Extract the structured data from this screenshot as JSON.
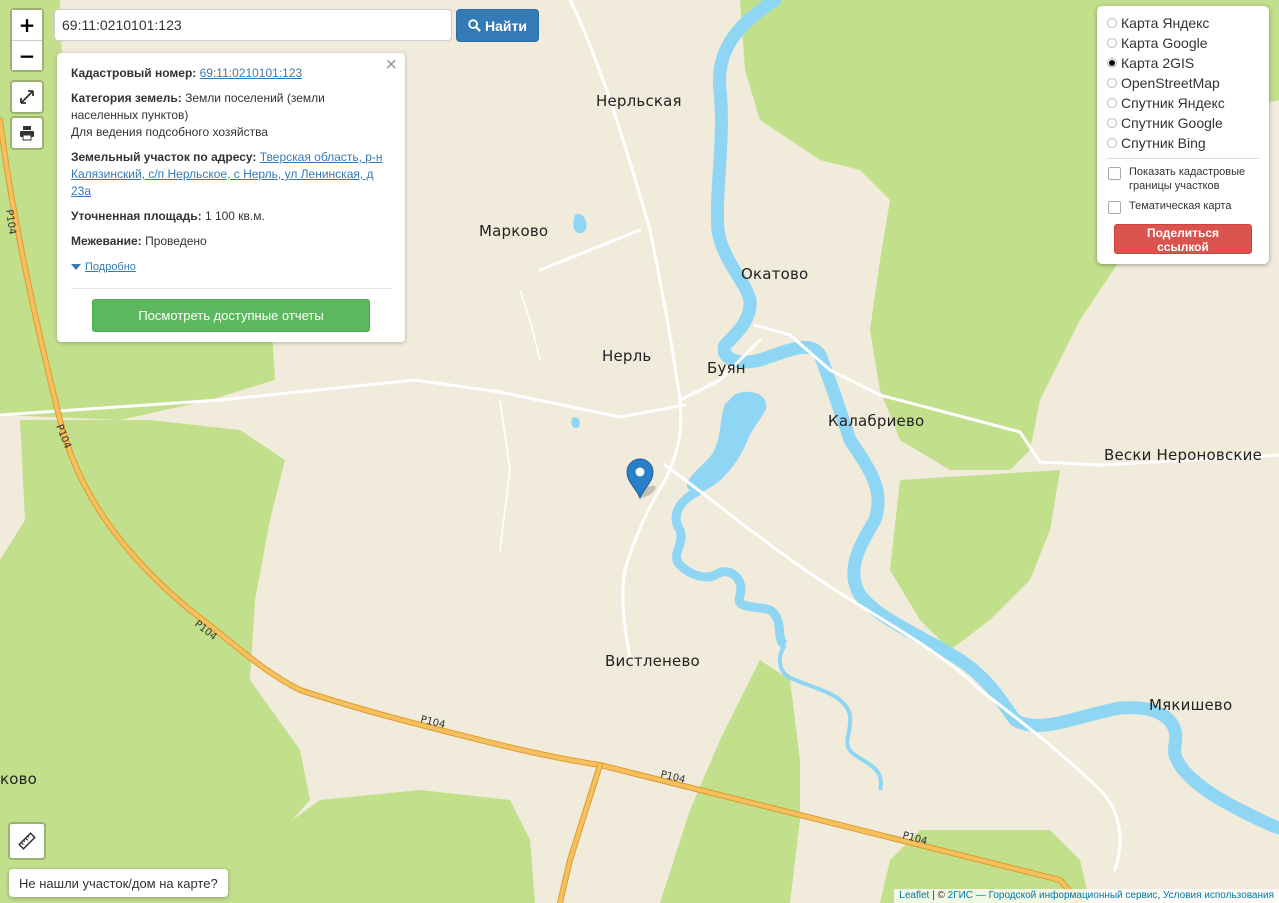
{
  "search": {
    "value": "69:11:0210101:123",
    "button_label": "Найти"
  },
  "zoom": {
    "in": "+",
    "out": "−"
  },
  "info": {
    "cadastral_label": "Кадастровый номер:",
    "cadastral_value": "69:11:0210101:123",
    "category_label": "Категория земель:",
    "category_value": "Земли поселений (земли населенных пунктов)",
    "category_note": "Для ведения подсобного хозяйства",
    "address_label": "Земельный участок по адресу:",
    "address_value": "Тверская область, р-н Калязинский, с/п Нерльское, с Нерль, ул Ленинская, д 23а",
    "area_label": "Уточненная площадь:",
    "area_value": "1 100 кв.м.",
    "survey_label": "Межевание:",
    "survey_value": "Проведено",
    "more_label": "Подробно",
    "reports_button": "Посмотреть доступные отчеты"
  },
  "layers": {
    "options": [
      "Карта Яндекс",
      "Карта Google",
      "Карта 2GIS",
      "OpenStreetMap",
      "Спутник Яндекс",
      "Спутник Google",
      "Спутник Bing"
    ],
    "selected": "Карта 2GIS",
    "cadastral_borders": "Показать кадастровые границы участков",
    "thematic": "Тематическая карта",
    "share_button": "Поделиться ссылкой"
  },
  "not_found": "Не нашли участок/дом на карте?",
  "attribution": {
    "leaflet": "Leaflet",
    "sep": " | © ",
    "provider": "2ГИС — Городской информационный сервис",
    "comma": ", ",
    "terms": "Условия использования"
  },
  "map_labels": {
    "nerlskaya": "Нерльская",
    "markovo": "Марково",
    "okatovo": "Окатово",
    "nerl": "Нерль",
    "buyan": "Буян",
    "kalabrievo": "Калабриево",
    "veski": "Вески Нероновские",
    "vistlenevo": "Вистленево",
    "myakishevo": "Мякишево",
    "kovo": "ково",
    "road_p104": "Р104"
  },
  "colors": {
    "land": "#f1ebdb",
    "forest": "#c2df8c",
    "water": "#8fd6f5",
    "road_main": "#f0b23e",
    "marker": "#2a7fc9"
  }
}
